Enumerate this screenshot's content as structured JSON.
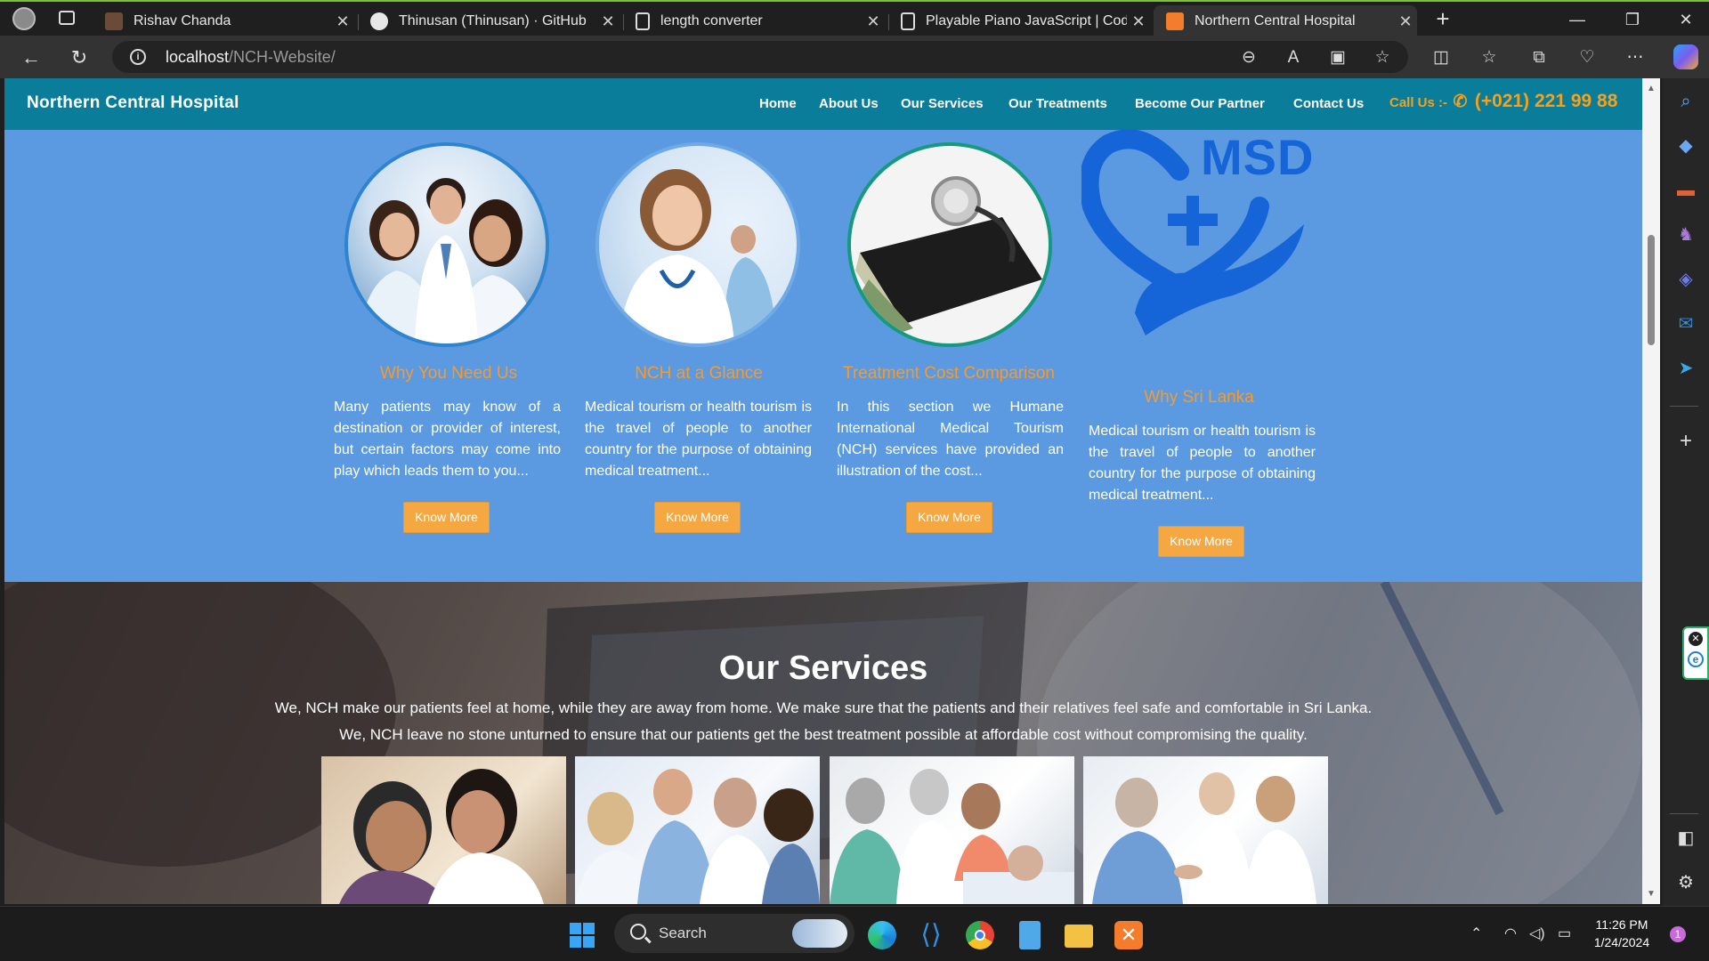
{
  "browser": {
    "tabs": [
      {
        "title": "Rishav Chanda"
      },
      {
        "title": "Thinusan (Thinusan) · GitHub"
      },
      {
        "title": "length converter"
      },
      {
        "title": "Playable Piano JavaScript | Codin"
      },
      {
        "title": "Northern Central Hospital",
        "active": true
      }
    ],
    "url_host": "localhost",
    "url_path": "/NCH-Website/"
  },
  "site": {
    "brand": "Northern Central Hospital",
    "nav": [
      "Home",
      "About Us",
      "Our Services",
      "Our Treatments",
      "Become Our Partner",
      "Contact Us"
    ],
    "call_label": "Call Us :-",
    "call_number": "(+021) 221 99 88"
  },
  "cards": [
    {
      "title": "Why You Need Us",
      "text": "Many patients may know of a destination or provider of interest, but certain factors may come into play which leads them to you...",
      "button": "Know More",
      "image": "doctors-team-photo"
    },
    {
      "title": "NCH at a Glance",
      "text": "Medical tourism or health tourism is the travel of people to another country for the purpose of obtaining medical treatment...",
      "button": "Know More",
      "image": "female-doctor-photo"
    },
    {
      "title": "Treatment Cost Comparison",
      "text": "In this section we Humane International Medical Tourism (NCH) services have provided an illustration of the cost...",
      "button": "Know More",
      "image": "stethoscope-wallet-photo"
    },
    {
      "title": "Why Sri Lanka",
      "text": "Medical tourism or health tourism is the travel of people to another country for the purpose of obtaining medical treatment...",
      "button": "Know More",
      "image": "msd-heart-logo",
      "logo_text": "MSD"
    }
  ],
  "services": {
    "title": "Our Services",
    "line1": "We, NCH make our patients feel at home, while they are away from home.  We make sure that the patients and their relatives feel safe and comfortable in Sri Lanka.",
    "line2": "We, NCH leave no stone unturned to ensure that our patients get the best treatment possible at affordable cost without compromising the quality.",
    "photos": [
      "elderly-patient-nurse-photo",
      "doctors-meeting-photo",
      "doctors-bedside-photo",
      "handshake-doctor-photo"
    ]
  },
  "taskbar": {
    "search_label": "Search",
    "time": "11:26 PM",
    "date": "1/24/2024",
    "notification_count": "1"
  },
  "colors": {
    "page_bg": "#5b9ae0",
    "nav_bg": "#0a7d9b",
    "accent_orange": "#f79a2a",
    "button_orange": "#f5a742",
    "logo_blue": "#1565d8"
  }
}
